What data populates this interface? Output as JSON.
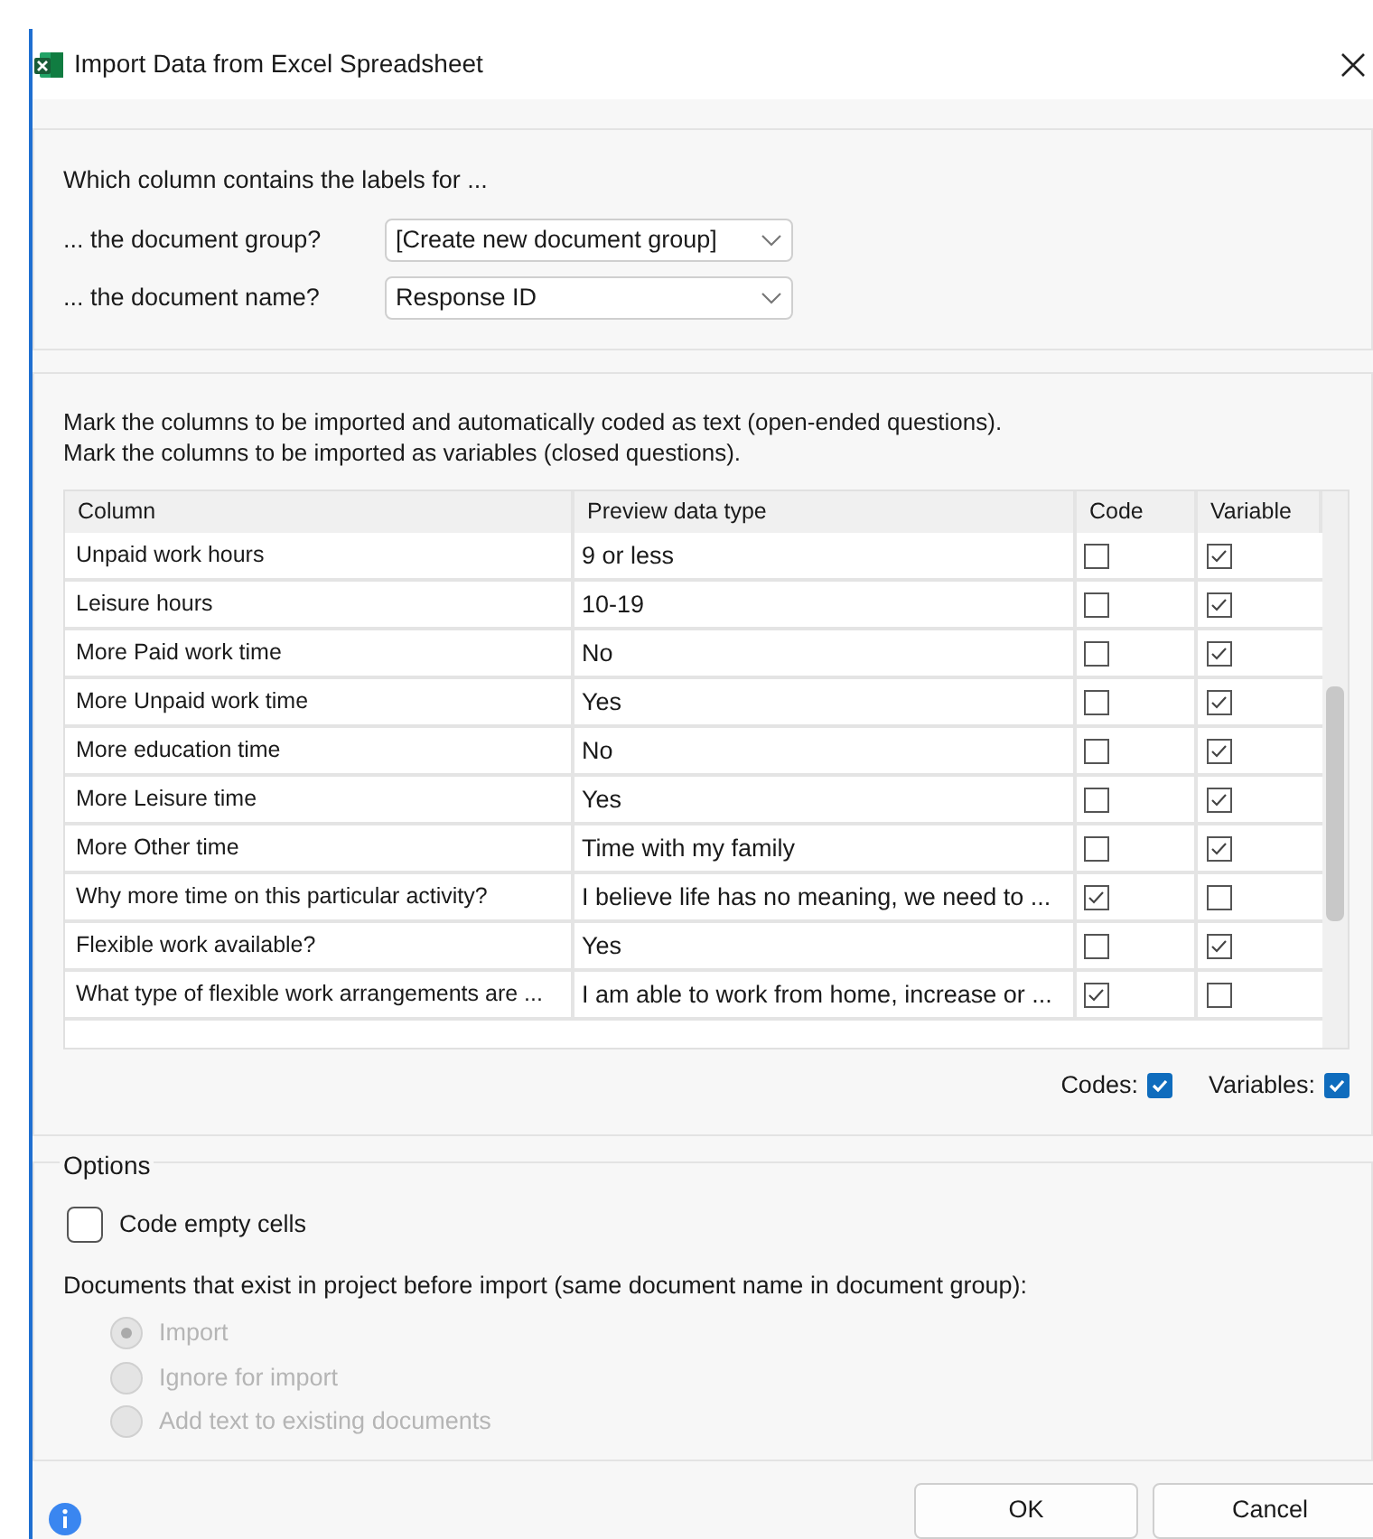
{
  "window": {
    "title": "Import Data from Excel Spreadsheet"
  },
  "labels_section": {
    "heading": "Which column contains the labels for ...",
    "fields": [
      {
        "label": "... the document group?",
        "value": "[Create new document group]"
      },
      {
        "label": "... the document name?",
        "value": "Response ID"
      }
    ]
  },
  "columns_section": {
    "instructions": [
      "Mark the columns to be imported and automatically coded as text (open-ended questions).",
      "Mark the columns to be imported as variables (closed questions)."
    ],
    "table": {
      "columns": [
        "Column",
        "Preview data type",
        "Code",
        "Variable"
      ],
      "rows": [
        {
          "column": "Unpaid work hours",
          "preview": "9 or less",
          "code": false,
          "variable": true
        },
        {
          "column": "Leisure hours",
          "preview": "10-19",
          "code": false,
          "variable": true
        },
        {
          "column": "More Paid work time",
          "preview": "No",
          "code": false,
          "variable": true
        },
        {
          "column": "More Unpaid work time",
          "preview": "Yes",
          "code": false,
          "variable": true
        },
        {
          "column": "More education time",
          "preview": "No",
          "code": false,
          "variable": true
        },
        {
          "column": "More Leisure time",
          "preview": "Yes",
          "code": false,
          "variable": true
        },
        {
          "column": "More Other time",
          "preview": "Time with my family",
          "code": false,
          "variable": true
        },
        {
          "column": "Why more time on this particular activity?",
          "preview": "I believe life has no meaning, we need to ...",
          "code": true,
          "variable": false
        },
        {
          "column": "Flexible work available?",
          "preview": "Yes",
          "code": false,
          "variable": true
        },
        {
          "column": "What type of flexible work arrangements are ...",
          "preview": "I am able to work from home, increase or ...",
          "code": true,
          "variable": false
        }
      ]
    },
    "toggles": [
      {
        "label": "Codes:",
        "checked": true
      },
      {
        "label": "Variables:",
        "checked": true
      }
    ]
  },
  "options": {
    "title": "Options",
    "checkbox": {
      "label": "Code empty cells",
      "checked": false
    },
    "existing_label": "Documents that exist in project before import (same document name in document group):",
    "radios": [
      {
        "label": "Import",
        "selected": true,
        "disabled": true
      },
      {
        "label": "Ignore for import",
        "selected": false,
        "disabled": true
      },
      {
        "label": "Add text to existing documents",
        "selected": false,
        "disabled": true
      }
    ]
  },
  "buttons": [
    "OK",
    "Cancel"
  ]
}
